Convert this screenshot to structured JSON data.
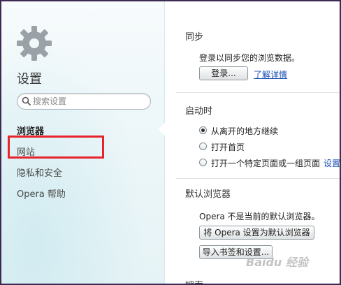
{
  "sidebar": {
    "title": "设置",
    "search_placeholder": "搜索设置",
    "items": [
      {
        "label": "浏览器",
        "active": true
      },
      {
        "label": "网站",
        "active": false
      },
      {
        "label": "隐私和安全",
        "active": false
      },
      {
        "label": "Opera 帮助",
        "active": false
      }
    ]
  },
  "sync": {
    "title": "同步",
    "description": "登录以同步您的浏览数据。",
    "login_button": "登录...",
    "learn_more_link": "了解详情"
  },
  "startup": {
    "title": "启动时",
    "options": [
      {
        "label": "从离开的地方继续",
        "checked": true
      },
      {
        "label": "打开首页",
        "checked": false
      },
      {
        "label": "打开一个特定页面或一组页面",
        "checked": false
      }
    ],
    "settings_link": "设置"
  },
  "default_browser": {
    "title": "默认浏览器",
    "description": "Opera 不是当前的默认浏览器。",
    "set_default_button": "将 Opera 设置为默认浏览器",
    "import_button": "导入书签和设置..."
  },
  "next_section": {
    "title": "搜索"
  },
  "watermark": "Baidu 经验",
  "colors": {
    "highlight": "#e8232e",
    "link": "#1a4fb5",
    "frame": "#3b2a52"
  }
}
